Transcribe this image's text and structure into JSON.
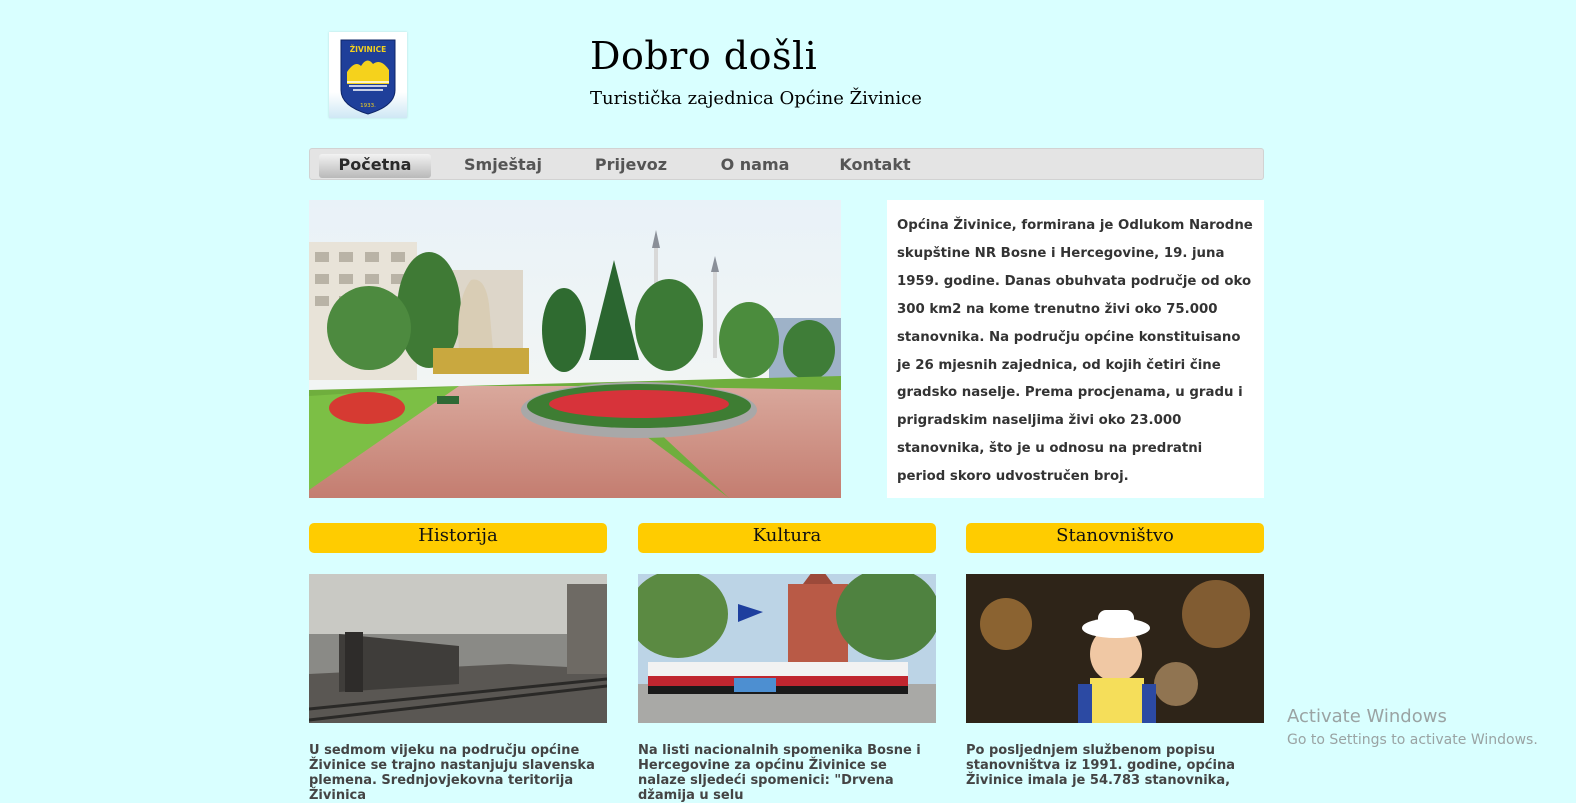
{
  "logo": {
    "text": "ŽIVINICE",
    "year": "1933."
  },
  "header": {
    "title": "Dobro došli",
    "subtitle": "Turistička zajednica Općine Živinice"
  },
  "nav": {
    "items": [
      "Početna",
      "Smještaj",
      "Prijevoz",
      "O nama",
      "Kontakt"
    ],
    "active": "Početna"
  },
  "intro": {
    "text": "Općina Živinice, formirana je Odlukom Narodne skupštine NR Bosne i Hercegovine, 19. juna 1959. godine. Danas obuhvata područje od oko 300 km2 na kome trenutno živi oko 75.000 stanovnika. Na području općine konstituisano je 26 mjesnih zajednica, od kojih četiri čine gradsko naselje. Prema procjenama, u gradu i prigradskim naseljima živi oko 23.000 stanovnika, što je u odnosu na predratni period skoro udvostručen broj."
  },
  "sections": [
    {
      "heading": "Historija",
      "text": "U sedmom vijeku na području općine Živinice se trajno nastanjuju slavenska plemena. Srednjovjekovna teritorija Živinica"
    },
    {
      "heading": "Kultura",
      "text": "Na listi nacionalnih spomenika Bosne i Hercegovine za općinu Živinice se nalaze sljedeći spomenici: \"Drvena džamija u selu"
    },
    {
      "heading": "Stanovništvo",
      "text": "Po posljednjem službenom popisu stanovništva iz 1991. godine, općina Živinice imala je 54.783 stanovnika,"
    }
  ],
  "watermark": {
    "title": "Activate Windows",
    "subtitle": "Go to Settings to activate Windows."
  },
  "colors": {
    "background": "#d9ffff",
    "section_heading": "#ffcc00",
    "nav_bar": "#e4e4e4"
  }
}
